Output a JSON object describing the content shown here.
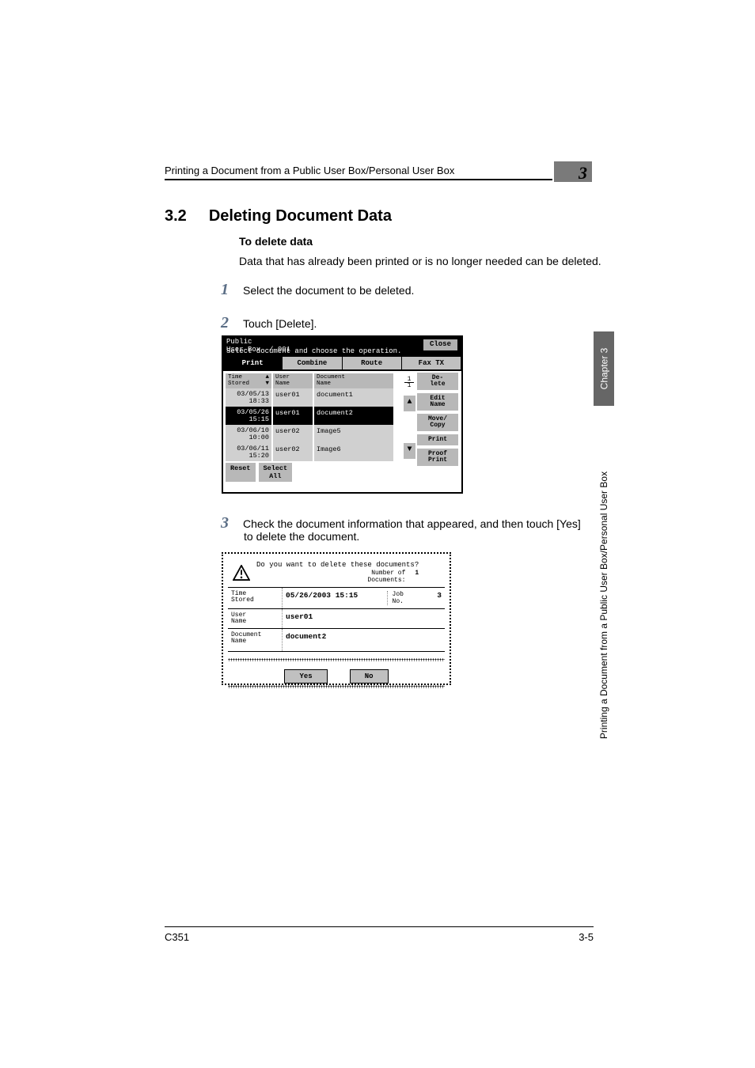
{
  "header": {
    "breadcrumb": "Printing a Document from a Public User Box/Personal User Box",
    "chapter_badge": "3"
  },
  "section": {
    "number": "3.2",
    "title": "Deleting Document Data"
  },
  "subtitle": "To delete data",
  "intro": "Data that has already been printed or is no longer needed can be deleted.",
  "steps": {
    "s1": {
      "n": "1",
      "t": "Select the document to be deleted."
    },
    "s2": {
      "n": "2",
      "t": "Touch [Delete]."
    },
    "s3": {
      "n": "3",
      "t": "Check the document information that appeared, and then touch [Yes]",
      "cont": "to delete the document."
    }
  },
  "side_tab": {
    "dark": "Chapter 3",
    "light": "Printing a Document from a Public User Box/Personal User Box"
  },
  "footer": {
    "left": "C351",
    "right": "3-5"
  },
  "shot1": {
    "title_l1": "Public",
    "title_l2": "User Box",
    "box_no": "/ 001",
    "instruction": "Select document and choose the operation.",
    "close": "Close",
    "tabs": [
      "Print",
      "Combine",
      "Route",
      "Fax TX"
    ],
    "headers": {
      "time": "Time\nStored",
      "user": "User\nName",
      "doc": "Document\nName"
    },
    "rows": [
      {
        "time": "03/05/13\n18:33",
        "user": "user01",
        "doc": "document1",
        "sel": false
      },
      {
        "time": "03/05/26\n15:15",
        "user": "user01",
        "doc": "document2",
        "sel": true
      },
      {
        "time": "03/06/10\n10:00",
        "user": "user02",
        "doc": "Image5",
        "sel": false
      },
      {
        "time": "03/06/11\n15:20",
        "user": "user02",
        "doc": "Image6",
        "sel": false
      }
    ],
    "bottom": {
      "reset": "Reset",
      "select_all": "Select\nAll"
    },
    "side": {
      "delete": "De-\nlete",
      "edit": "Edit\nName",
      "move": "Move/\nCopy",
      "print": "Print",
      "proof": "Proof\nPrint"
    },
    "page": {
      "num": "1",
      "den": "1"
    },
    "arrows": {
      "up": "▲",
      "down": "▼"
    }
  },
  "shot2": {
    "question": "Do you want to delete these documents?",
    "numdoc_label": "Number of\nDocuments:",
    "numdoc_val": "1",
    "rows": [
      {
        "label": "Time\nStored",
        "val_left": "05/26/2003  15:15",
        "val_mid": "Job\nNo.",
        "val_right": "3"
      },
      {
        "label": "User\nName",
        "val_left": "user01",
        "val_mid": "",
        "val_right": ""
      },
      {
        "label": "Document\nName",
        "val_left": "document2",
        "val_mid": "",
        "val_right": ""
      }
    ],
    "yes": "Yes",
    "no": "No"
  }
}
